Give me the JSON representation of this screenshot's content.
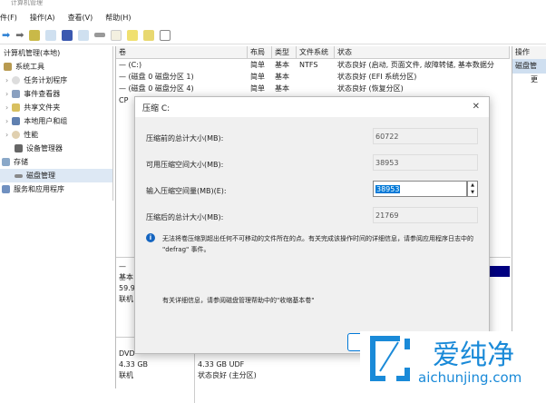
{
  "window": {
    "title": "计算机管理"
  },
  "menu": [
    "件(F)",
    "操作(A)",
    "查看(V)",
    "帮助(H)"
  ],
  "tree": {
    "root": "计算机管理(本地)",
    "items": [
      {
        "label": "系统工具",
        "indent": 0
      },
      {
        "label": "任务计划程序",
        "indent": 1
      },
      {
        "label": "事件查看器",
        "indent": 1
      },
      {
        "label": "共享文件夹",
        "indent": 1
      },
      {
        "label": "本地用户和组",
        "indent": 1
      },
      {
        "label": "性能",
        "indent": 1
      },
      {
        "label": "设备管理器",
        "indent": 1
      },
      {
        "label": "存储",
        "indent": 0
      },
      {
        "label": "磁盘管理",
        "indent": 1
      },
      {
        "label": "服务和应用程序",
        "indent": 0
      }
    ]
  },
  "volumes": {
    "headers": [
      "卷",
      "布局",
      "类型",
      "文件系统",
      "状态"
    ],
    "rows": [
      [
        "(C:)",
        "简单",
        "基本",
        "NTFS",
        "状态良好 (启动, 页面文件, 故障转储, 基本数据分"
      ],
      [
        "(磁盘 0 磁盘分区 1)",
        "简单",
        "基本",
        "",
        "状态良好 (EFI 系统分区)"
      ],
      [
        "(磁盘 0 磁盘分区 4)",
        "简单",
        "基本",
        "",
        "状态良好 (恢复分区)"
      ],
      [
        "CP",
        "",
        "",
        "",
        ""
      ]
    ]
  },
  "actions": {
    "title": "操作",
    "item": "磁盘管",
    "more": "更"
  },
  "disks": {
    "disk0": [
      "基本",
      "59.9",
      "联机"
    ],
    "dvd": [
      "DVD",
      "4.33 GB",
      "联机"
    ],
    "dvd_part": [
      "4.33 GB UDF",
      "状态良好 (主分区)"
    ]
  },
  "dialog": {
    "title": "压缩 C:",
    "fields": [
      {
        "label": "压缩前的总计大小(MB):",
        "value": "60722"
      },
      {
        "label": "可用压缩空间大小(MB):",
        "value": "38953"
      },
      {
        "label": "输入压缩空间量(MB)(E):",
        "value": "38953"
      },
      {
        "label": "压缩后的总计大小(MB):",
        "value": "21769"
      }
    ],
    "info": "无法将卷压缩到超出任何不可移动的文件所在的点。有关完成该操作时间的详细信息，请参阅应用程序日志中的 \"defrag\" 事件。",
    "help": "有关详细信息，请参阅磁盘管理帮助中的\"收缩基本卷\"",
    "close": "✕"
  },
  "watermark": {
    "name": "爱纯净",
    "url": "aichunjing.com"
  }
}
